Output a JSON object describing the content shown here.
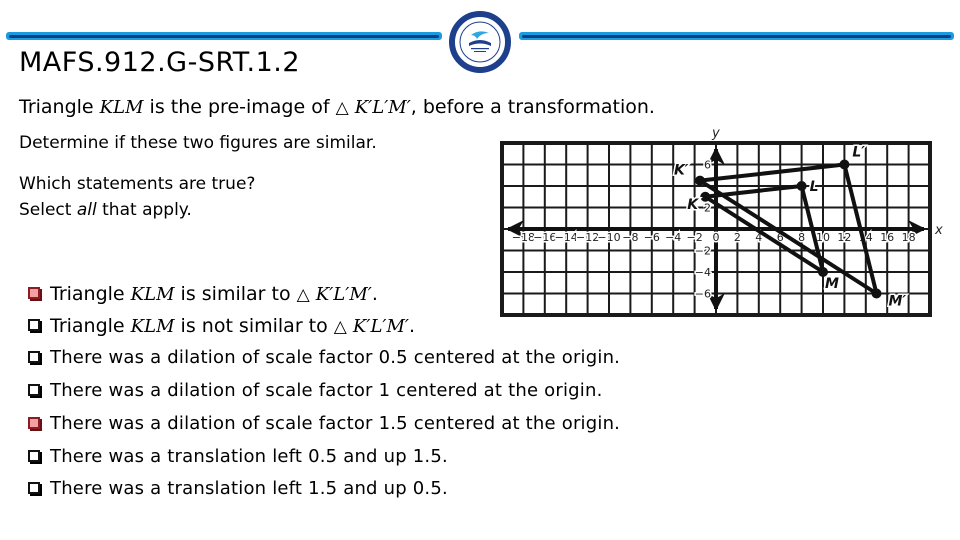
{
  "header": {
    "title": "MAFS.912.G-SRT.1.2",
    "logo": "school-district-seal-logo",
    "accent_color": "#1a9be0",
    "accent_dark": "#0d3f86"
  },
  "question": {
    "line1_pre": "Triangle ",
    "line1_math1": "KLM",
    "line1_mid": " is the pre-image of ",
    "line1_triangle_symbol": "△",
    "line1_math2": "K′L′M′",
    "line1_post": ", before a transformation.",
    "line2": "Determine if these two figures are similar.",
    "line3": "Which statements are true?",
    "line4_pre": "Select ",
    "line4_em": "all",
    "line4_post": " that apply."
  },
  "graph": {
    "x_axis_label": "x",
    "y_axis_label": "y",
    "x_range": [
      -20,
      20
    ],
    "y_range": [
      -8,
      8
    ],
    "grid_step": 2,
    "x_tick_labels": [
      "−18",
      "−16",
      "−14",
      "−12",
      "−10",
      "−8",
      "−6",
      "−4",
      "−2",
      "0",
      "2",
      "4",
      "6",
      "8",
      "10",
      "12",
      "14",
      "16",
      "18"
    ],
    "x_tick_values": [
      -18,
      -16,
      -14,
      -12,
      -10,
      -8,
      -6,
      -4,
      -2,
      0,
      2,
      4,
      6,
      8,
      10,
      12,
      14,
      16,
      18
    ],
    "y_tick_labels": [
      "6",
      "2",
      "−2",
      "−4",
      "−6"
    ],
    "y_tick_values": [
      6,
      2,
      -2,
      -4,
      -6
    ],
    "pre_image": {
      "name": "KLM",
      "points": [
        {
          "label": "K",
          "x": -1,
          "y": 3
        },
        {
          "label": "L",
          "x": 8,
          "y": 4
        },
        {
          "label": "M",
          "x": 10,
          "y": -4
        }
      ]
    },
    "image": {
      "name": "K'L'M'",
      "points": [
        {
          "label": "K′",
          "x": -1.5,
          "y": 4.5
        },
        {
          "label": "L′",
          "x": 12,
          "y": 6
        },
        {
          "label": "M′",
          "x": 15,
          "y": -6
        }
      ]
    }
  },
  "options": [
    {
      "pre": "Triangle ",
      "math": "KLM",
      "mid": " is similar to ",
      "tri": "△",
      "math2": "K′L′M′",
      "post": ".",
      "checked": true
    },
    {
      "pre": "Triangle ",
      "math": "KLM",
      "mid": " is not similar to ",
      "tri": "△",
      "math2": "K′L′M′",
      "post": ".",
      "checked": false
    },
    {
      "text": "There was a dilation of scale factor 0.5 centered at the origin.",
      "checked": false
    },
    {
      "text": "There was a dilation of scale factor 1 centered at the origin.",
      "checked": false
    },
    {
      "text": "There was a dilation of scale factor 1.5 centered at the origin.",
      "checked": true
    },
    {
      "text": "There was a translation left 0.5 and up 1.5.",
      "checked": false
    },
    {
      "text": "There was a translation left 1.5 and up 0.5.",
      "checked": false
    }
  ],
  "checkbox_checked_color": "#f2a0a4"
}
